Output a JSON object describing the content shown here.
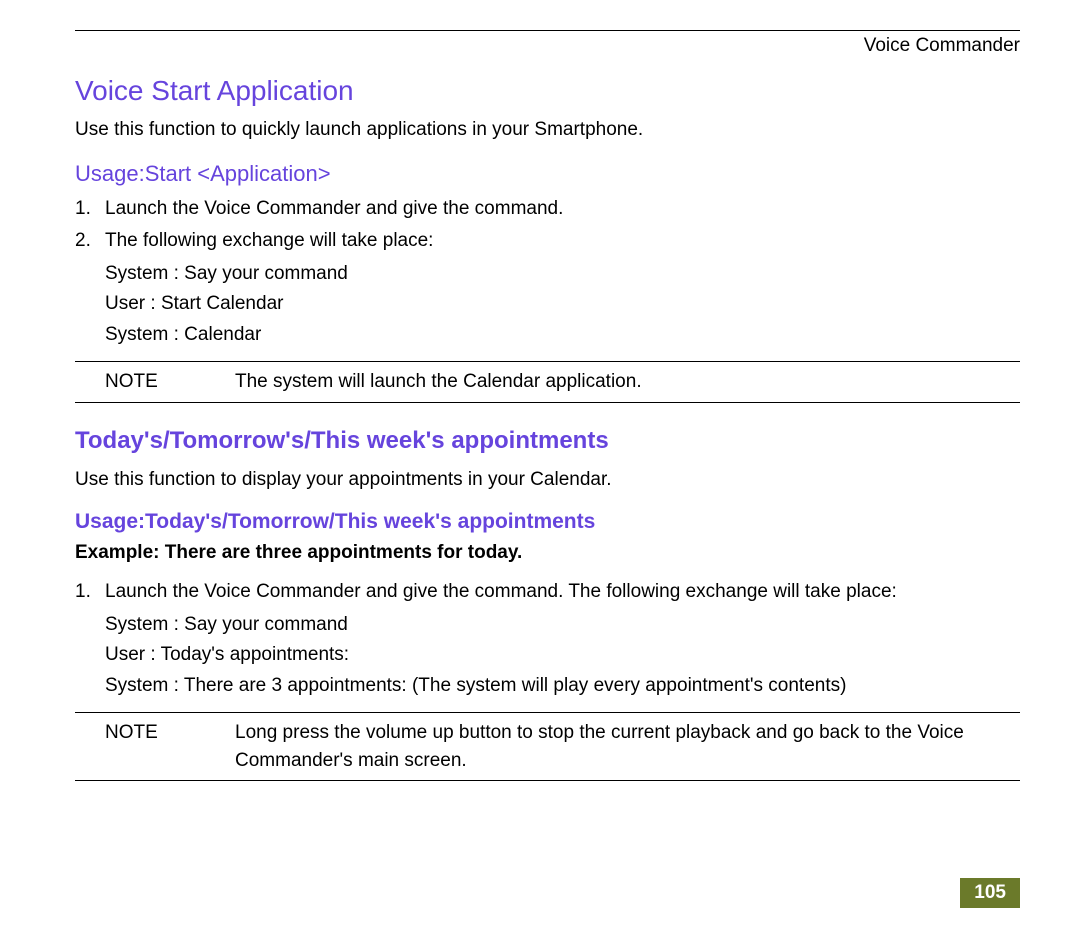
{
  "header": {
    "title": "Voice Commander"
  },
  "section1": {
    "title": "Voice Start Application",
    "intro": "Use this function to quickly launch applications in your Smartphone.",
    "usage_heading": "Usage:Start <Application>",
    "steps": {
      "item1": "Launch the Voice Commander and give the command.",
      "item2": "The following exchange will take place:"
    },
    "exchange": {
      "line1": "System :  Say your command",
      "line2": "User :  Start Calendar",
      "line3": "System :  Calendar"
    },
    "note": {
      "label": "NOTE",
      "text": "The system will launch the Calendar application."
    }
  },
  "section2": {
    "title": "Today's/Tomorrow's/This week's appointments",
    "intro": "Use this function to display your appointments in your Calendar.",
    "usage_heading": "Usage:Today's/Tomorrow/This week's appointments",
    "example": "Example: There are three appointments for today.",
    "steps": {
      "item1": "Launch the Voice Commander and give the command. The following exchange will take place:"
    },
    "exchange": {
      "line1": "System :  Say your command",
      "line2": "User :  Today's appointments:",
      "line3": "System :  There are 3 appointments: (The system will play every appointment's contents)"
    },
    "note": {
      "label": "NOTE",
      "text": "Long press the volume up button to stop the current playback and go back to the Voice Commander's main screen."
    }
  },
  "page_number": "105"
}
